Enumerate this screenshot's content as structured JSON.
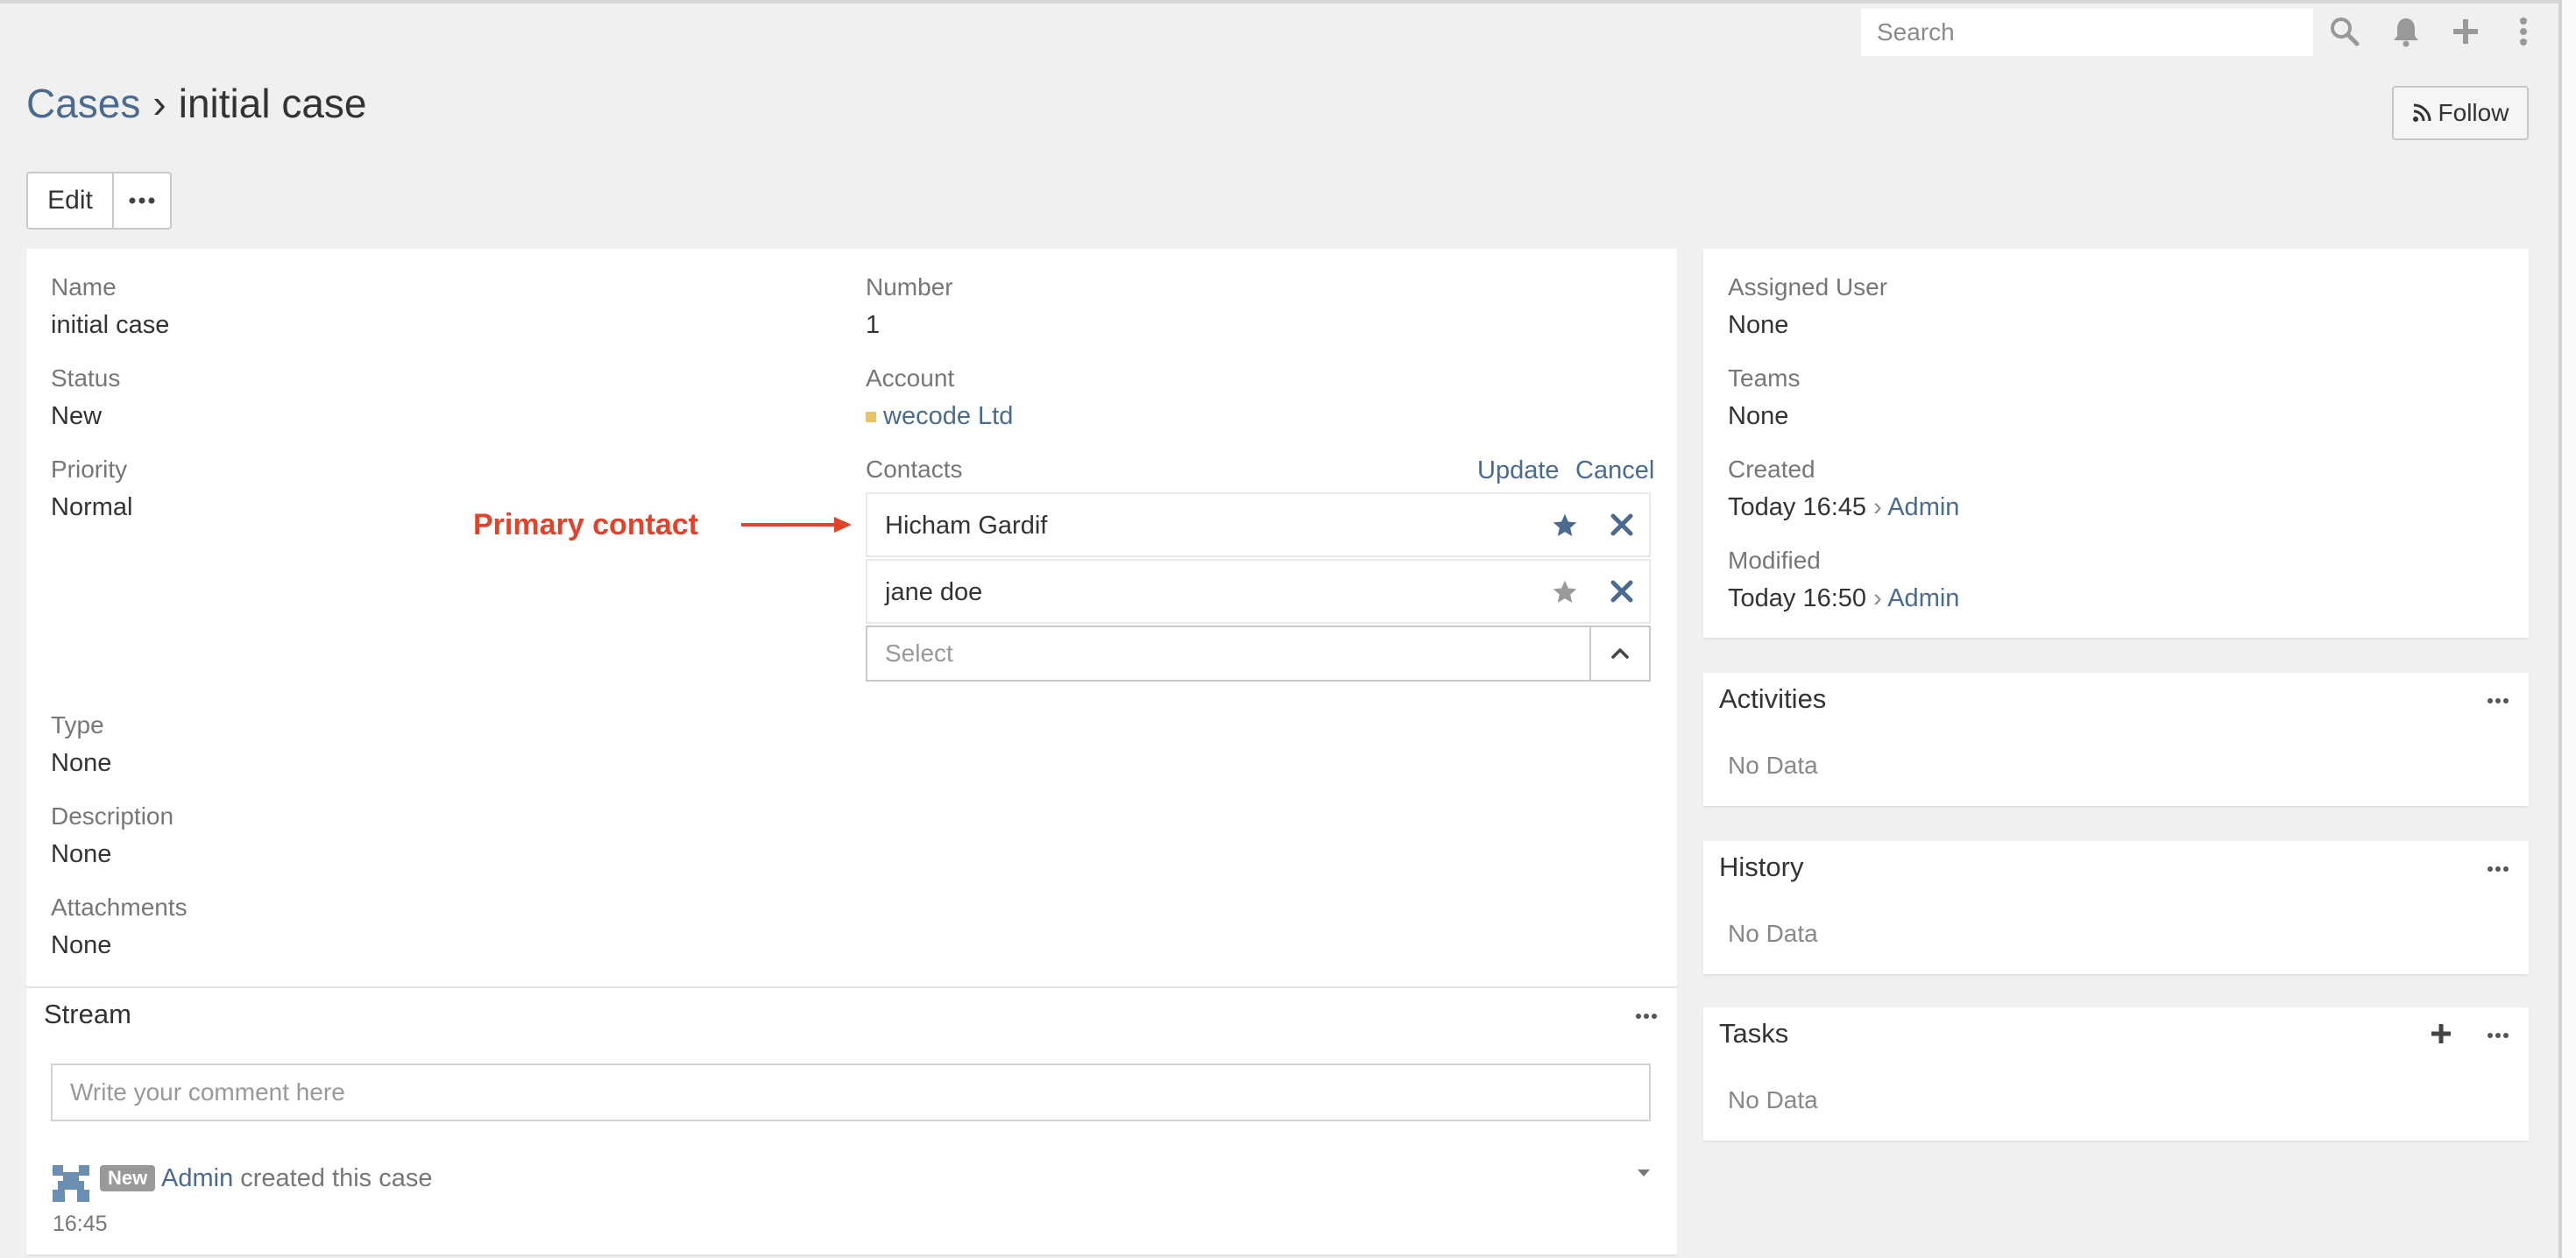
{
  "navbar": {
    "search_placeholder": "Search",
    "icons": [
      "search-icon",
      "bell-icon",
      "plus-icon",
      "kebab-menu-icon"
    ]
  },
  "header": {
    "breadcrumb_parent": "Cases",
    "breadcrumb_separator": "›",
    "breadcrumb_current": "initial case",
    "follow_label": "Follow"
  },
  "actions": {
    "edit_label": "Edit"
  },
  "detail": {
    "name_label": "Name",
    "name_value": "initial case",
    "status_label": "Status",
    "status_value": "New",
    "priority_label": "Priority",
    "priority_value": "Normal",
    "number_label": "Number",
    "number_value": "1",
    "account_label": "Account",
    "account_value": "wecode Ltd",
    "contacts_label": "Contacts",
    "update_label": "Update",
    "cancel_label": "Cancel",
    "contacts": [
      {
        "name": "Hicham Gardif",
        "primary": true
      },
      {
        "name": "jane doe",
        "primary": false
      }
    ],
    "select_placeholder": "Select",
    "type_label": "Type",
    "type_value": "None",
    "description_label": "Description",
    "description_value": "None",
    "attachments_label": "Attachments",
    "attachments_value": "None"
  },
  "annotation": {
    "text": "Primary contact"
  },
  "stream": {
    "title": "Stream",
    "comment_placeholder": "Write your comment here",
    "entry": {
      "badge": "New",
      "user": "Admin",
      "action": "created this case",
      "time": "16:45"
    }
  },
  "side": {
    "assigned_user_label": "Assigned User",
    "assigned_user_value": "None",
    "teams_label": "Teams",
    "teams_value": "None",
    "created_label": "Created",
    "created_value": "Today 16:45",
    "created_by": "Admin",
    "modified_label": "Modified",
    "modified_value": "Today 16:50",
    "modified_by": "Admin",
    "by_separator": "›"
  },
  "panels": {
    "activities_title": "Activities",
    "activities_empty": "No Data",
    "history_title": "History",
    "history_empty": "No Data",
    "tasks_title": "Tasks",
    "tasks_empty": "No Data"
  },
  "colors": {
    "link": "#4a6b8f",
    "annotation": "#e0432c",
    "primary_star": "#4a6b8f",
    "secondary_star": "#999999",
    "account_marker": "#e6c46a"
  }
}
